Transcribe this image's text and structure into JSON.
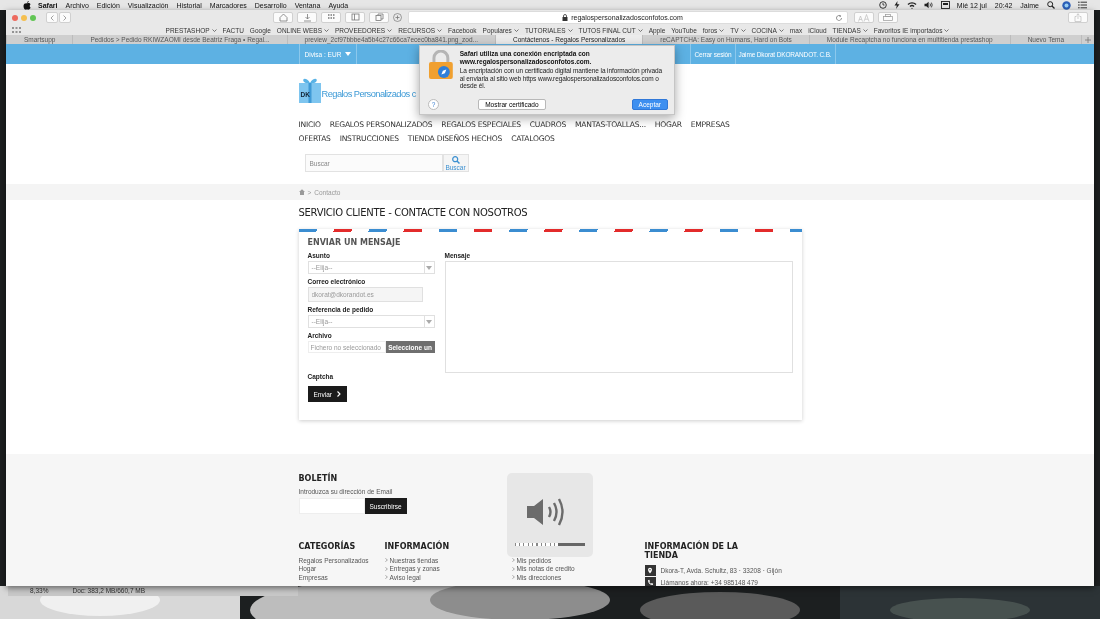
{
  "menu_bar": {
    "app": "Safari",
    "menus": [
      "Archivo",
      "Edición",
      "Visualización",
      "Historial",
      "Marcadores",
      "Desarrollo",
      "Ventana",
      "Ayuda"
    ],
    "date": "Mié 12 jul",
    "time": "20:42",
    "user": "Jaime"
  },
  "browser": {
    "address": "regalospersonalizadosconfotos.com",
    "bookmarks": [
      {
        "label": "PRESTASHOP",
        "menu": true
      },
      {
        "label": "FACTU",
        "menu": false
      },
      {
        "label": "Google",
        "menu": false
      },
      {
        "label": "ONLINE WEBS",
        "menu": true
      },
      {
        "label": "PROVEEDORES",
        "menu": true
      },
      {
        "label": "RECURSOS",
        "menu": true
      },
      {
        "label": "Facebook",
        "menu": false
      },
      {
        "label": "Populares",
        "menu": true
      },
      {
        "label": "TUTORIALES",
        "menu": true
      },
      {
        "label": "TUTOS FINAL CUT",
        "menu": true
      },
      {
        "label": "Apple",
        "menu": false
      },
      {
        "label": "YouTube",
        "menu": false
      },
      {
        "label": "foros",
        "menu": true
      },
      {
        "label": "TV",
        "menu": true
      },
      {
        "label": "COCINA",
        "menu": true
      },
      {
        "label": "max",
        "menu": false
      },
      {
        "label": "iCloud",
        "menu": false
      },
      {
        "label": "TIENDAS",
        "menu": true
      },
      {
        "label": "Favoritos IE importados",
        "menu": true
      }
    ],
    "tabs": [
      {
        "title": "Smartsupp",
        "selected": false
      },
      {
        "title": "Pedidos > Pedido RKIWZAOMI desde Beatriz Fraga • Regal...",
        "selected": false
      },
      {
        "title": "preview_2cf97bbbe4a5b4c27c66ca7ecec0ba841.png_zod...",
        "selected": false
      },
      {
        "title": "Contáctenos - Regalos Personalizados",
        "selected": true
      },
      {
        "title": "reCAPTCHA: Easy on Humans, Hard on Bots",
        "selected": false
      },
      {
        "title": "Module Recaptcha no funciona en multitienda prestashop",
        "selected": false
      },
      {
        "title": "Nuevo Tema",
        "selected": false
      }
    ]
  },
  "page": {
    "top_bar": {
      "currency": "Divisa : EUR",
      "logout": "Cerrar sesión",
      "account": "Jaime Dkorat DKORANDOT. C.B."
    },
    "logo_badge": "DK",
    "logo_text": "Regalos Personalizados c",
    "nav_rows": [
      [
        "INICIO",
        "REGALOS PERSONALIZADOS",
        "REGALOS ESPECIALES",
        "CUADROS",
        "MANTAS-TOALLAS...",
        "HOGAR",
        "EMPRESAS"
      ],
      [
        "OFERTAS",
        "INSTRUCCIONES",
        "TIENDA DISEÑOS HECHOS",
        "CATALOGOS"
      ]
    ],
    "search": {
      "placeholder": "Buscar",
      "button": "Buscar"
    },
    "breadcrumb": [
      ">",
      "Contacto"
    ],
    "title": "SERVICIO CLIENTE - CONTACTE CON NOSOTROS",
    "form": {
      "heading": "ENVIAR UN MENSAJE",
      "subject": {
        "label": "Asunto",
        "value": "--Elija--"
      },
      "email": {
        "label": "Correo electrónico",
        "value": "dkorat@dkorandot.es"
      },
      "order": {
        "label": "Referencia de pedido",
        "value": "--Elija--"
      },
      "file": {
        "label": "Archivo",
        "status": "Fichero no seleccionado",
        "button": "Seleccione un"
      },
      "message": {
        "label": "Mensaje"
      },
      "captcha": "Captcha",
      "submit": "Enviar"
    },
    "footer": {
      "newsletter": {
        "heading": "BOLETÍN",
        "text": "Introduzca su dirección de Email",
        "button": "Suscribirse"
      },
      "columns": [
        {
          "heading": "CATEGORÍAS",
          "kind": "plain",
          "links": [
            "Regalos Personalizados",
            "Hogar",
            "Empresas"
          ]
        },
        {
          "heading": "INFORMACIÓN",
          "kind": "arrow",
          "links": [
            "Nuestras tiendas",
            "Entregas y zonas",
            "Aviso legal"
          ]
        },
        {
          "kind": "arrow",
          "links": [
            "Mis pedidos",
            "Mis notas de credito",
            "Mis direcciones"
          ]
        }
      ],
      "store": {
        "heading": "INFORMACIÓN DE LA TIENDA",
        "lines": [
          {
            "kind": "location",
            "text": "Dkora-T, Avda. Schultz, 83 · 33208 · Gijón"
          },
          {
            "kind": "phone",
            "text": "Llámanos ahora: +34 985148 479"
          }
        ]
      }
    }
  },
  "dialog": {
    "title": "Safari utiliza una conexión encriptada con www.regalospersonalizadosconfotos.com.",
    "body": "La encriptación con un certificado digital mantiene la información privada al enviarla al sitio web https www.regalospersonalizadosconfotos.com o desde él.",
    "help": "?",
    "buttons": [
      {
        "label": "Mostrar certificado",
        "default": false
      },
      {
        "label": "Aceptar",
        "default": true
      }
    ]
  },
  "volume_hud": {
    "level": 0.62
  },
  "background_app": {
    "zoom": "8,33%",
    "doc": "Doc: 383,2 MB/660,7 MB"
  }
}
